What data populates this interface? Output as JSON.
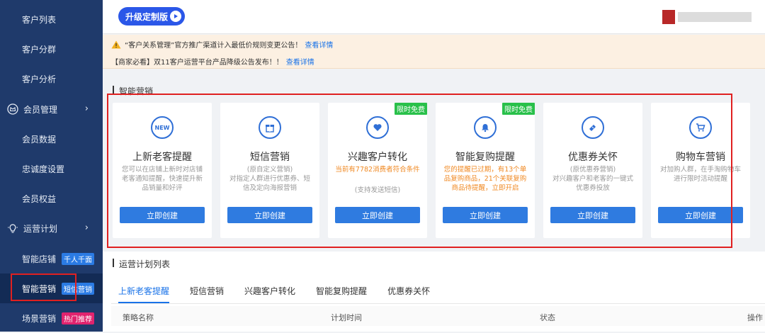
{
  "sidebar": {
    "items": [
      {
        "label": "客户列表"
      },
      {
        "label": "客户分群"
      },
      {
        "label": "客户分析"
      },
      {
        "label": "会员管理",
        "icon": "crown-icon"
      },
      {
        "label": "会员数据"
      },
      {
        "label": "忠诚度设置"
      },
      {
        "label": "会员权益"
      },
      {
        "label": "运营计划",
        "icon": "bulb-icon"
      },
      {
        "label": "智能店铺",
        "tag": "千人千面",
        "tag_color": "#2b7be4"
      },
      {
        "label": "智能营销",
        "tag": "短信营销",
        "tag_color": "#2b7be4"
      },
      {
        "label": "场景营销",
        "tag": "热门推荐",
        "tag_color": "#e0236e"
      }
    ]
  },
  "topbar": {
    "upgrade_label": "升级定制版"
  },
  "notice": {
    "line1": "“客户关系管理”官方推广渠道计入最低价规则变更公告！",
    "line1_link": "查看详情",
    "line2": "【商家必看】双11客户运营平台产品降级公告发布！！",
    "line2_link": "查看详情"
  },
  "smart_marketing": {
    "section_title": "智能营销",
    "cards": [
      {
        "title": "上新老客提醒",
        "icon": "new-icon",
        "icon_text": "NEW",
        "desc": "您可以在店铺上新时对店铺老客通知提醒，快速提升新品销量和好评",
        "desc2": "",
        "button": "立即创建",
        "badge": ""
      },
      {
        "title": "短信营销",
        "icon": "gift-icon",
        "desc": "(原自定义营销)",
        "desc2": "对指定人群进行优惠券、短信及定向海报营销",
        "button": "立即创建",
        "badge": ""
      },
      {
        "title": "兴趣客户转化",
        "icon": "heart-icon",
        "desc": "当前有7782消费者符合条件",
        "desc2": "(支持发送短信)",
        "button": "立即创建",
        "badge": "限时免费"
      },
      {
        "title": "智能复购提醒",
        "icon": "bell-icon",
        "desc": "您的提醒已过期，有13个单品复购商品，21个关联复购商品待提醒，立即开启",
        "desc2": "",
        "button": "立即创建",
        "badge": "限时免费"
      },
      {
        "title": "优惠券关怀",
        "icon": "ticket-icon",
        "desc": "(原优惠券营销)",
        "desc2": "对兴趣客户和老客的一键式优惠券投放",
        "button": "立即创建",
        "badge": ""
      },
      {
        "title": "购物车营销",
        "icon": "cart-icon",
        "desc": "对加购人群，在手淘购物车进行限时活动提醒",
        "desc2": "",
        "button": "立即创建",
        "badge": ""
      }
    ]
  },
  "plan_list": {
    "section_title": "运营计划列表",
    "tabs": [
      "上新老客提醒",
      "短信营销",
      "兴趣客户转化",
      "智能复购提醒",
      "优惠券关怀"
    ],
    "columns": [
      "策略名称",
      "计划时间",
      "状态",
      "操作"
    ]
  },
  "colors": {
    "sidebar_bg": "#1f3a6b",
    "accent": "#2f7be0",
    "warn_bg": "#fcf0e2",
    "badge_green": "#29c04a",
    "highlight_red": "#e02020"
  }
}
